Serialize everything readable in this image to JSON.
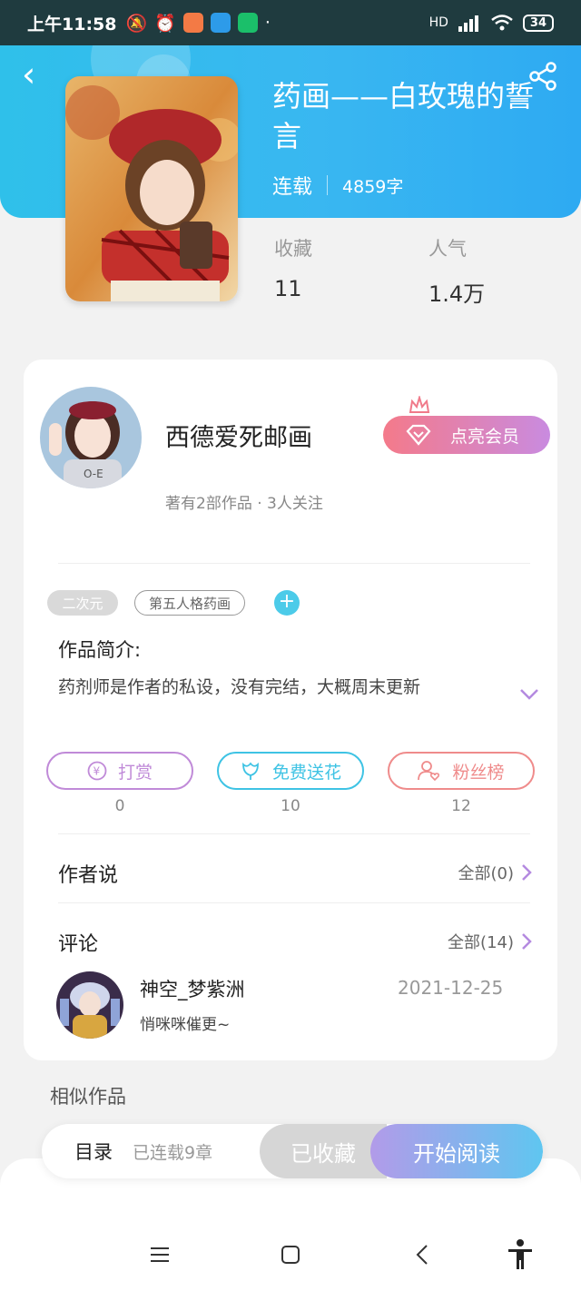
{
  "status_bar": {
    "time": "上午11:58",
    "battery": "34",
    "network": "HD"
  },
  "book": {
    "title": "药画——白玫瑰的誓言",
    "status": "连载",
    "word_count": "4859字",
    "stats": [
      {
        "label": "收藏",
        "value": "11"
      },
      {
        "label": "人气",
        "value": "1.4万"
      }
    ]
  },
  "author": {
    "name": "西德爱死邮画",
    "meta": "著有2部作品 · 3人关注",
    "vip_label": "点亮会员"
  },
  "tags": [
    "二次元",
    "第五人格药画"
  ],
  "intro": {
    "title": "作品简介:",
    "text": "药剂师是作者的私设，没有完结，大概周末更新"
  },
  "actions": [
    {
      "label": "打赏",
      "count": "0",
      "color": "#c08ad8"
    },
    {
      "label": "免费送花",
      "count": "10",
      "color": "#3ec3e4"
    },
    {
      "label": "粉丝榜",
      "count": "12",
      "color": "#ef8b8b"
    }
  ],
  "author_says": {
    "title": "作者说",
    "link": "全部(0)"
  },
  "comments": {
    "title": "评论",
    "link": "全部(14)",
    "items": [
      {
        "user": "神空_梦紫洲",
        "date": "2021-12-25",
        "text": "悄咪咪催更~"
      }
    ]
  },
  "similar_title": "相似作品",
  "bottom_bar": {
    "toc_label": "目录",
    "toc_sub": "已连载9章",
    "fav_label": "已收藏",
    "read_label": "开始阅读"
  },
  "colors": {
    "header": "#39b7f1",
    "accent": "#c08ad8"
  }
}
